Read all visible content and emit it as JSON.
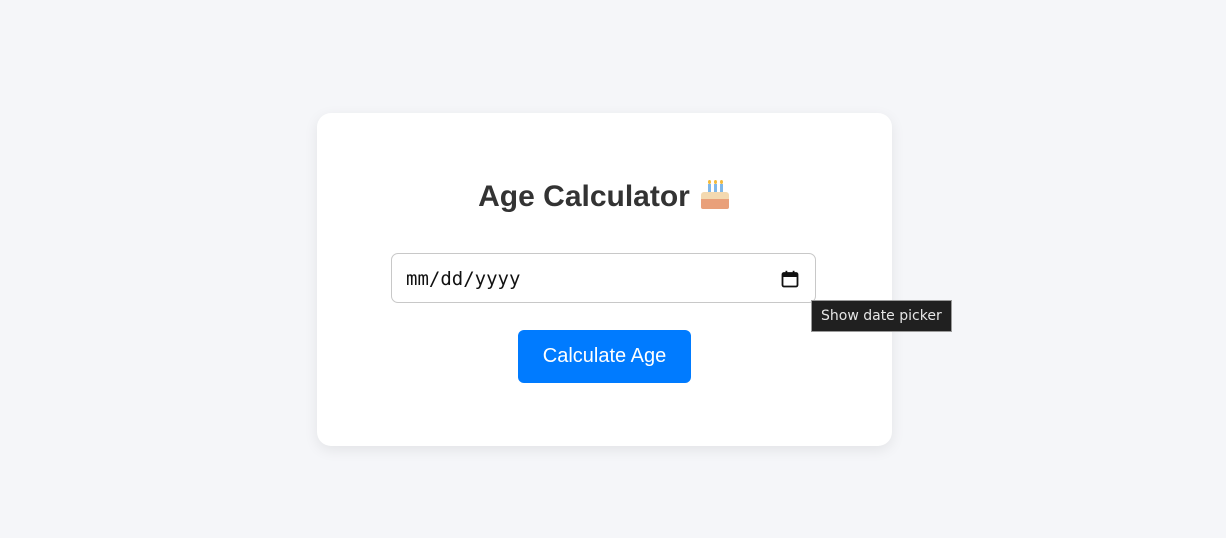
{
  "app": {
    "title": "Age Calculator",
    "title_icon": "birthday-cake-icon"
  },
  "date_input": {
    "placeholder": "mm/dd/yyyy",
    "value": "",
    "icon": "calendar-icon"
  },
  "button": {
    "label": "Calculate Age",
    "color": "#007bff"
  },
  "tooltip": {
    "text": "Show date picker"
  },
  "colors": {
    "background": "#f5f6f9",
    "card": "#ffffff",
    "title": "#333333"
  }
}
